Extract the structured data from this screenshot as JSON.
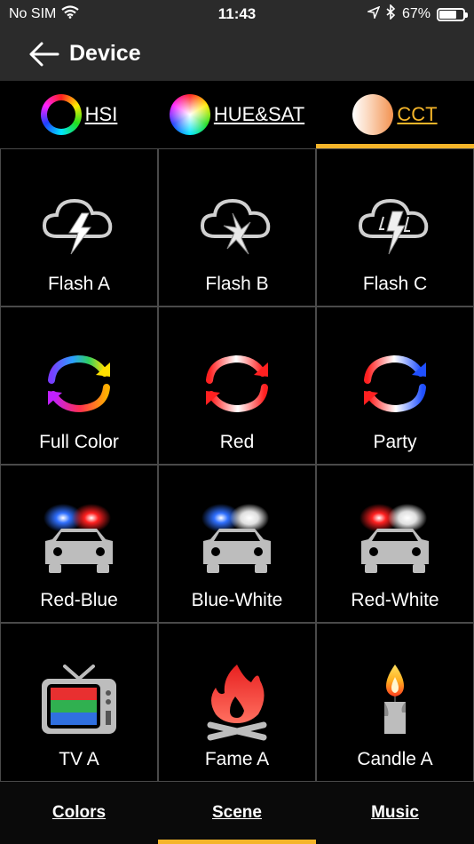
{
  "status_bar": {
    "carrier": "No SIM",
    "time": "11:43",
    "battery_text": "67%",
    "battery_level": 0.67
  },
  "nav": {
    "title": "Device"
  },
  "mode_tabs": [
    {
      "label": "HSI",
      "active": false
    },
    {
      "label": "HUE&SAT",
      "active": false
    },
    {
      "label": "CCT",
      "active": true
    }
  ],
  "scenes": [
    {
      "label": "Flash A",
      "icon": "lightning-cloud-icon"
    },
    {
      "label": "Flash B",
      "icon": "lightning-cloud-icon"
    },
    {
      "label": "Flash C",
      "icon": "lightning-cloud-icon"
    },
    {
      "label": "Full Color",
      "icon": "refresh-cycle-icon"
    },
    {
      "label": "Red",
      "icon": "refresh-cycle-icon"
    },
    {
      "label": "Party",
      "icon": "refresh-cycle-icon"
    },
    {
      "label": "Red-Blue",
      "icon": "police-car-icon"
    },
    {
      "label": "Blue-White",
      "icon": "police-car-icon"
    },
    {
      "label": "Red-White",
      "icon": "police-car-icon"
    },
    {
      "label": "TV A",
      "icon": "tv-icon"
    },
    {
      "label": "Fame A",
      "icon": "campfire-icon"
    },
    {
      "label": "Candle A",
      "icon": "candle-icon"
    }
  ],
  "bottom_tabs": [
    {
      "label": "Colors",
      "active": false
    },
    {
      "label": "Scene",
      "active": true
    },
    {
      "label": "Music",
      "active": false
    }
  ],
  "colors": {
    "accent": "#f5b52a",
    "nav_background": "#2b2b2b",
    "grid_line": "#4a4a4a"
  }
}
